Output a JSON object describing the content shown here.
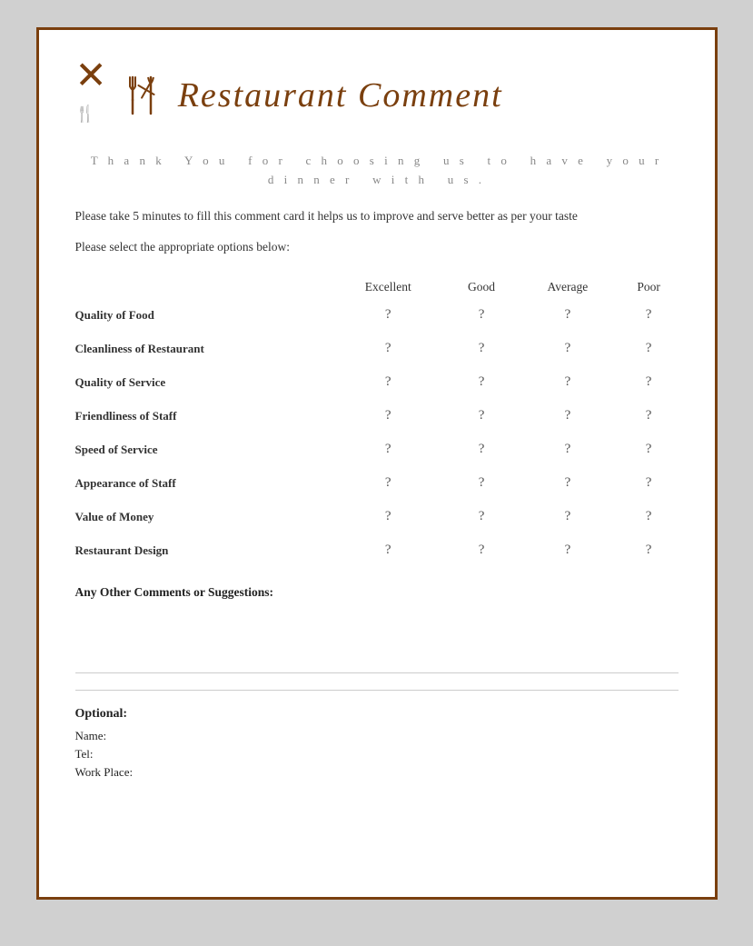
{
  "page": {
    "border_color": "#7a3f0e",
    "title": "Restaurant Comment",
    "icon": "🍴",
    "thank_you_text": "T h a n k  Y o u  f o r  c h o o s i n g  u s  t o  h a v e  y o u r\nd i n n e r  w i t h  u s .",
    "description": "Please take 5 minutes to fill this comment card it helps us to improve and serve better as per your taste",
    "instruction": "Please select the appropriate options below:",
    "table": {
      "headers": [
        "",
        "Excellent",
        "Good",
        "Average",
        "Poor"
      ],
      "rows": [
        {
          "label": "Quality of Food"
        },
        {
          "label": "Cleanliness of Restaurant"
        },
        {
          "label": "Quality of Service"
        },
        {
          "label": "Friendliness of Staff"
        },
        {
          "label": "Speed of Service"
        },
        {
          "label": "Appearance of Staff"
        },
        {
          "label": "Value of Money"
        },
        {
          "label": "Restaurant Design"
        }
      ],
      "radio_placeholder": "?"
    },
    "comments_label": "Any Other Comments or Suggestions:",
    "optional": {
      "title": "Optional:",
      "fields": [
        "Name:",
        "Tel:",
        "Work Place:"
      ]
    }
  }
}
